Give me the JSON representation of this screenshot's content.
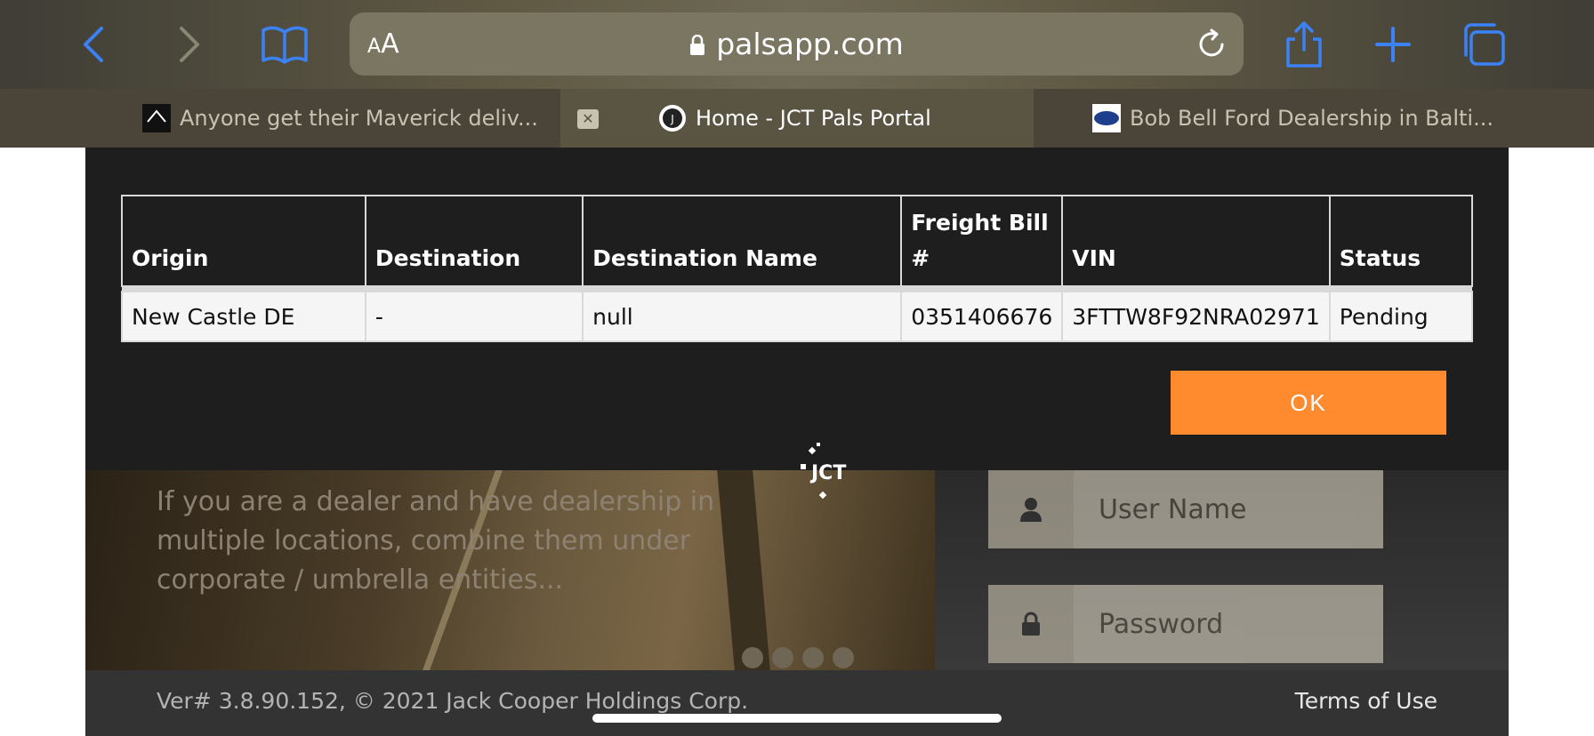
{
  "browser": {
    "aa_label": "AA",
    "url": "palsapp.com",
    "icons": [
      "back-icon",
      "forward-icon",
      "bookmarks-icon",
      "lock-icon",
      "reload-icon",
      "share-icon",
      "new-tab-icon",
      "tabs-icon"
    ],
    "tabs": [
      {
        "title": "Anyone get their Maverick deliv...",
        "active": false
      },
      {
        "title": "Home - JCT Pals Portal",
        "active": true
      },
      {
        "title": "Bob Bell Ford Dealership in Balti...",
        "active": false
      }
    ],
    "tab_close_label": "✕"
  },
  "modal": {
    "columns": [
      "Origin",
      "Destination",
      "Destination Name",
      "Freight Bill #",
      "VIN",
      "Status"
    ],
    "rows": [
      {
        "origin": "New Castle DE",
        "destination": "-",
        "destination_name": "null",
        "freight_bill": "0351406676",
        "vin": "3FTTW8F92NRA02971",
        "status": "Pending"
      }
    ],
    "ok_label": "OK"
  },
  "page": {
    "logo_text": "JCT",
    "hero_text": "If you are a dealer and have dealership in multiple locations, combine them under corporate / umbrella entities...",
    "username_placeholder": "User Name",
    "password_placeholder": "Password",
    "footer_version": "Ver# 3.8.90.152, © 2021 Jack Cooper Holdings Corp.",
    "footer_terms": "Terms of Use"
  },
  "colors": {
    "accent_button": "#ff8b2e",
    "modal_bg": "#1e1e1e",
    "browser_blue": "#3b82f6"
  }
}
